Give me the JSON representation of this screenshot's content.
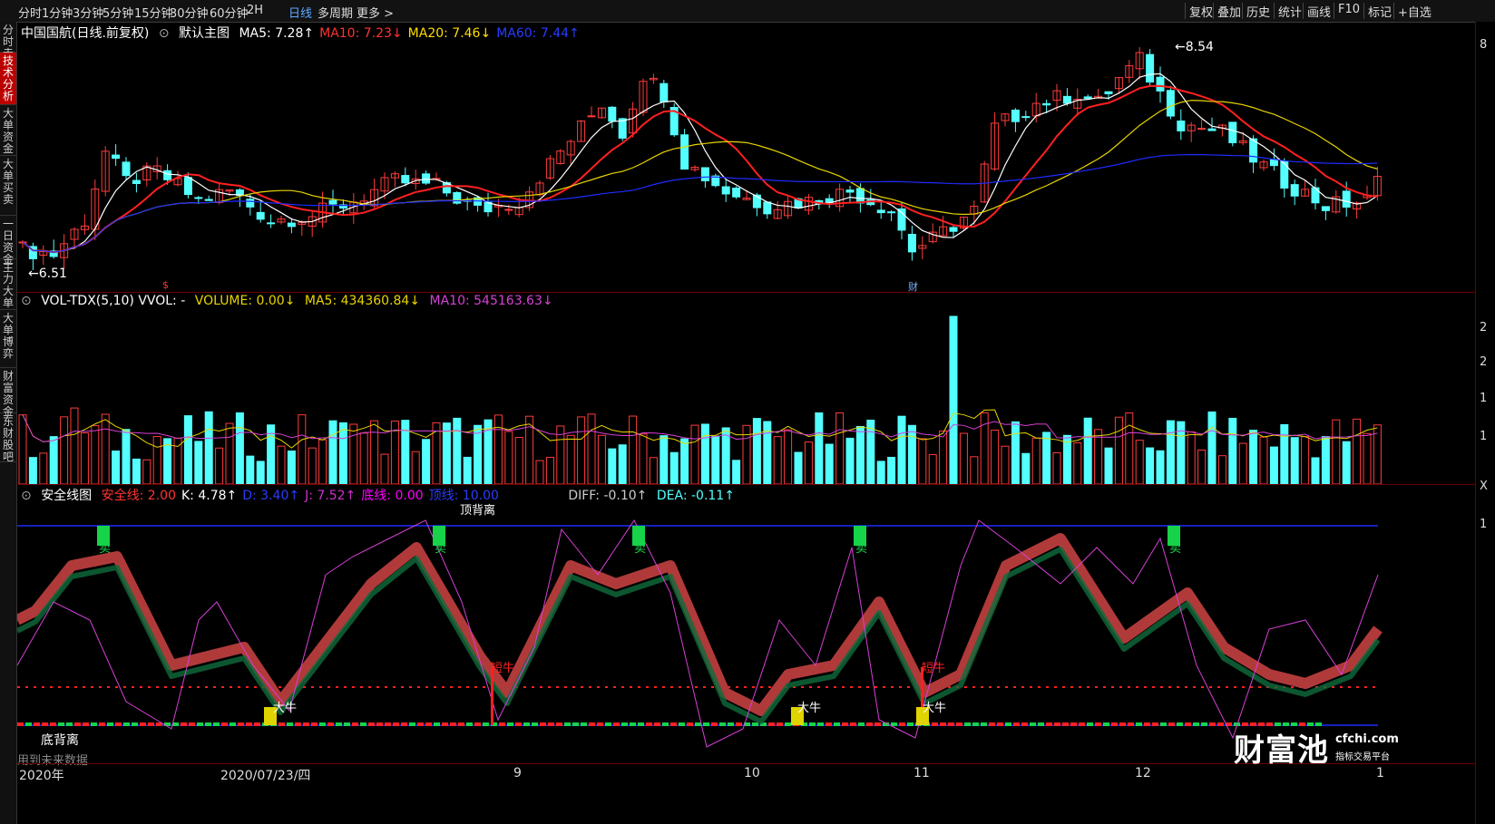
{
  "toolbar": {
    "periods": [
      "分时",
      "1分钟",
      "3分钟",
      "5分钟",
      "15分钟",
      "30分钟",
      "60分钟",
      "2H",
      "日线",
      "多周期",
      "更多 >"
    ],
    "active_period": "日线",
    "right_buttons": [
      "复权",
      "叠加",
      "历史",
      "统计",
      "画线",
      "F10",
      "标记",
      "+自选"
    ]
  },
  "sidebar": {
    "tabs": [
      "分时走势",
      "技术分析",
      "大单资金",
      "大单买卖",
      "一日资金",
      "主力大单",
      "大单博弈",
      "财富资金",
      "东财股吧"
    ],
    "active_tab": "技术分析"
  },
  "main_panel": {
    "title": "中国国航(日线.前复权)",
    "template": "默认主图",
    "ma": [
      {
        "label": "MA5: 7.28↑",
        "color": "#ffffff"
      },
      {
        "label": "MA10: 7.23↓",
        "color": "#ff3333"
      },
      {
        "label": "MA20: 7.46↓",
        "color": "#ffdd00"
      },
      {
        "label": "MA60: 7.44↑",
        "color": "#2a3cff"
      }
    ],
    "high_label": "8.54",
    "low_label": "6.51",
    "event_mark_1": "$",
    "event_mark_2": "财",
    "axis_top": "8"
  },
  "volume_panel": {
    "name": "VOL-TDX(5,10) VVOL: -",
    "volume": "VOLUME: 0.00↓",
    "ma5": "MA5: 434360.84↓",
    "ma10": "MA10: 545163.63↓",
    "axis": [
      "2",
      "2",
      "1",
      "1",
      "X"
    ]
  },
  "indicator_panel": {
    "name": "安全线图",
    "params": [
      {
        "label": "安全线: 2.00",
        "color": "#ff3333"
      },
      {
        "label": "K: 4.78↑",
        "color": "#ffffff"
      },
      {
        "label": "D: 3.40↑",
        "color": "#2a3cff"
      },
      {
        "label": "J: 7.52↑",
        "color": "#cc33cc"
      },
      {
        "label": "底线: 0.00",
        "color": "#ff00ff"
      },
      {
        "label": "顶线: 10.00",
        "color": "#2a3cff"
      }
    ],
    "diff": "DIFF: -0.10↑",
    "dea": "DEA: -0.11↑",
    "sell_label": "卖",
    "short_bull": "短牛",
    "big_bull": "大牛",
    "bottom_divergence": "底背离",
    "top_divergence": "顶背离",
    "future_data": "用到未来数据",
    "axis_top": "1"
  },
  "x_axis": {
    "labels": [
      "2020年",
      "2020/07/23/四",
      "9",
      "10",
      "11",
      "12",
      "1"
    ]
  },
  "watermark": {
    "brand": "财富池",
    "site": "cfchi.com",
    "slogan": "指标交易平台"
  },
  "colors": {
    "up": "#ff3b3b",
    "down": "#54ffff",
    "ma5": "#ffffff",
    "ma10": "#ff2020",
    "ma20": "#e8d400",
    "ma60": "#1e2cff",
    "k_band_up": "#b03a3a",
    "k_band_down": "#0f6b3c",
    "j_line": "#d640d6",
    "dashed": "#ff2020"
  }
}
